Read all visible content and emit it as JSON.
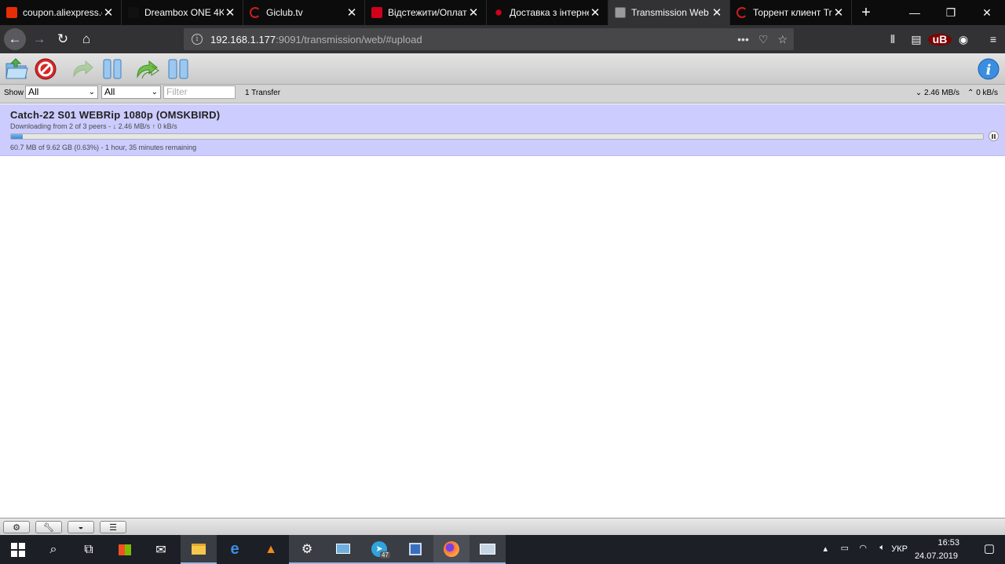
{
  "browser": {
    "tabs": [
      {
        "title": "coupon.aliexpress.c",
        "favicon": "aliexpress-icon",
        "color": "#e62e04"
      },
      {
        "title": "Dreambox ONE 4K",
        "favicon": "dreambox-icon",
        "color": "#111111"
      },
      {
        "title": "Giclub.tv",
        "favicon": "giclub-icon",
        "color": "#cc1f1f"
      },
      {
        "title": "Відстежити/Оплати",
        "favicon": "novaposhta-icon",
        "color": "#d0021b"
      },
      {
        "title": "Доставка з інтерне",
        "favicon": "novaposhta-dots-icon",
        "color": "#d0021b"
      },
      {
        "title": "Transmission Web I",
        "favicon": "transmission-icon",
        "color": "#888888",
        "active": true
      },
      {
        "title": "Торрент клиент Tra",
        "favicon": "giclub-icon",
        "color": "#cc1f1f"
      }
    ],
    "url_host": "192.168.1.177",
    "url_path": ":9091/transmission/web/#upload",
    "ub_label": "uB"
  },
  "toolbar": {
    "buttons": [
      "open-torrent",
      "remove-torrent",
      "resume-torrent",
      "pause-torrent",
      "resume-all",
      "pause-all",
      "inspector"
    ]
  },
  "filter": {
    "show_label": "Show",
    "state_value": "All",
    "tracker_value": "All",
    "filter_placeholder": "Filter",
    "transfer_count": "1 Transfer",
    "download_speed": "2.46 MB/s",
    "upload_speed": "0 kB/s"
  },
  "torrent": {
    "name": "Catch-22 S01 WEBRip 1080p (OMSKBIRD)",
    "peers": "Downloading from 2 of 3 peers - ↓ 2.46 MB/s ↑ 0 kB/s",
    "progress_text": "60.7 MB of 9.62 GB (0.63%) - 1 hour, 35 minutes remaining",
    "progress_fraction": 0.0063
  },
  "taskbar": {
    "lang": "УКР",
    "time": "16:53",
    "date": "24.07.2019",
    "telegram_badge": "47"
  }
}
